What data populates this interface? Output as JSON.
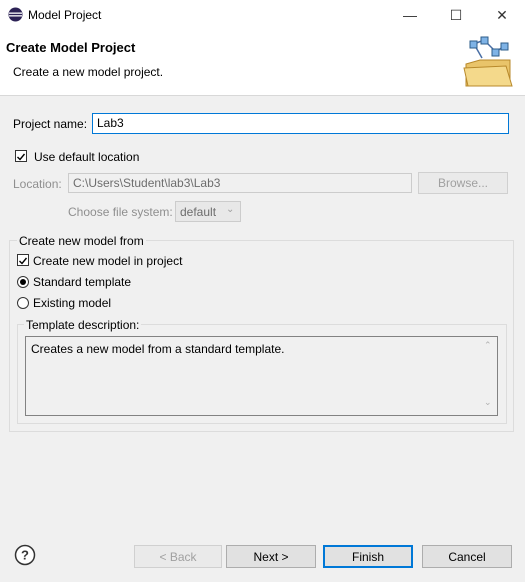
{
  "window": {
    "title": "Model Project",
    "minimize_glyph": "—",
    "maximize_glyph": "☐",
    "close_glyph": "✕",
    "app_icon": "eclipse-icon"
  },
  "header": {
    "title": "Create Model Project",
    "description": "Create a new model project."
  },
  "form": {
    "project_name_label": "Project name:",
    "project_name_value": "Lab3",
    "use_default_location_label": "Use default location",
    "use_default_location_checked": true,
    "location_label": "Location:",
    "location_value": "C:\\Users\\Student\\lab3\\Lab3",
    "browse_label": "Browse...",
    "file_system_label": "Choose file system:",
    "file_system_value": "default"
  },
  "model_group": {
    "title": "Create new model from",
    "create_in_project_label": "Create new model in project",
    "create_in_project_checked": true,
    "standard_template_label": "Standard template",
    "existing_model_label": "Existing model",
    "selected": "standard_template",
    "template_description_label": "Template description:",
    "template_description_text": "Creates a new model from a standard template."
  },
  "footer": {
    "help_icon": "help-icon",
    "back_label": "< Back",
    "next_label": "Next >",
    "finish_label": "Finish",
    "cancel_label": "Cancel"
  },
  "colors": {
    "accent": "#0078d7",
    "dialog_bg": "#f0f0f0"
  }
}
